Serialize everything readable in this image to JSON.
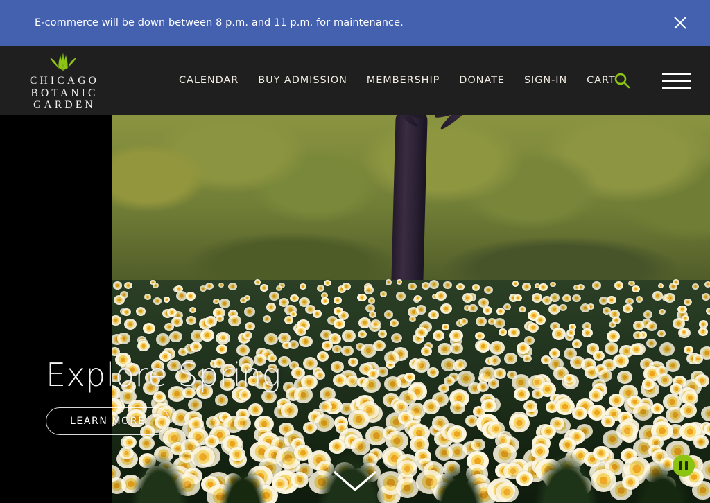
{
  "alert": {
    "message": "E-commerce will be down between 8 p.m. and 11 p.m. for maintenance.",
    "close_label": "close-icon",
    "background_color": "#4461AF",
    "text_color": "#FFFFFF"
  },
  "header": {
    "background_color": "#1F1F1F",
    "logo": {
      "mark": "sprout-leaf-icon",
      "mark_color": "#8DC414",
      "line1": "CHICAGO",
      "line2": "BOTANIC",
      "line3": "GARDEN"
    },
    "nav": [
      {
        "label": "CALENDAR",
        "name": "nav-item-calendar"
      },
      {
        "label": "BUY ADMISSION",
        "name": "nav-item-buy-admission"
      },
      {
        "label": "MEMBERSHIP",
        "name": "nav-item-membership"
      },
      {
        "label": "DONATE",
        "name": "nav-item-donate"
      },
      {
        "label": "SIGN-IN",
        "name": "nav-item-sign-in"
      },
      {
        "label": "CART",
        "name": "nav-item-cart"
      }
    ],
    "search_icon": "search-icon",
    "search_color": "#8DC414",
    "menu_icon": "hamburger-menu-icon"
  },
  "hero": {
    "title": "Explore Spring",
    "cta_label": "LEARN MORE",
    "image_description": "Field of white and yellow daffodils in front of a dark tree trunk and olive-green shrubs under blue sky",
    "scroll_icon": "chevron-down-icon",
    "pause_icon": "pause-icon",
    "pause_color": "#8DC414"
  }
}
